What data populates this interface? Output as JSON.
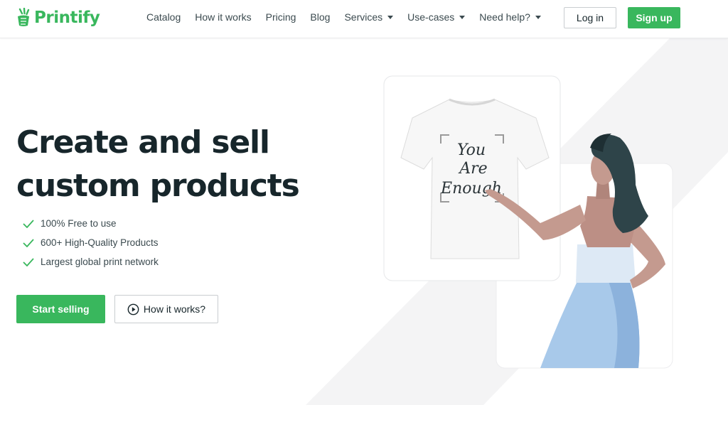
{
  "brand": {
    "name": "Printify",
    "accent": "#39b75d",
    "text_dark": "#17262b"
  },
  "nav": {
    "items": [
      {
        "label": "Catalog",
        "dropdown": false
      },
      {
        "label": "How it works",
        "dropdown": false
      },
      {
        "label": "Pricing",
        "dropdown": false
      },
      {
        "label": "Blog",
        "dropdown": false
      },
      {
        "label": "Services",
        "dropdown": true
      },
      {
        "label": "Use-cases",
        "dropdown": true
      },
      {
        "label": "Need help?",
        "dropdown": true
      }
    ]
  },
  "auth": {
    "login_label": "Log in",
    "signup_label": "Sign up"
  },
  "hero": {
    "title_line1": "Create and sell",
    "title_line2": "custom products",
    "features": [
      "100% Free to use",
      "600+ High-Quality Products",
      "Largest global print network"
    ],
    "primary_cta": "Start selling",
    "secondary_cta": "How it works?"
  },
  "illustration": {
    "tshirt_text": [
      "You",
      "Are",
      "Enough"
    ],
    "icons": [
      "tshirt-illustration",
      "woman-pointing-illustration"
    ]
  }
}
